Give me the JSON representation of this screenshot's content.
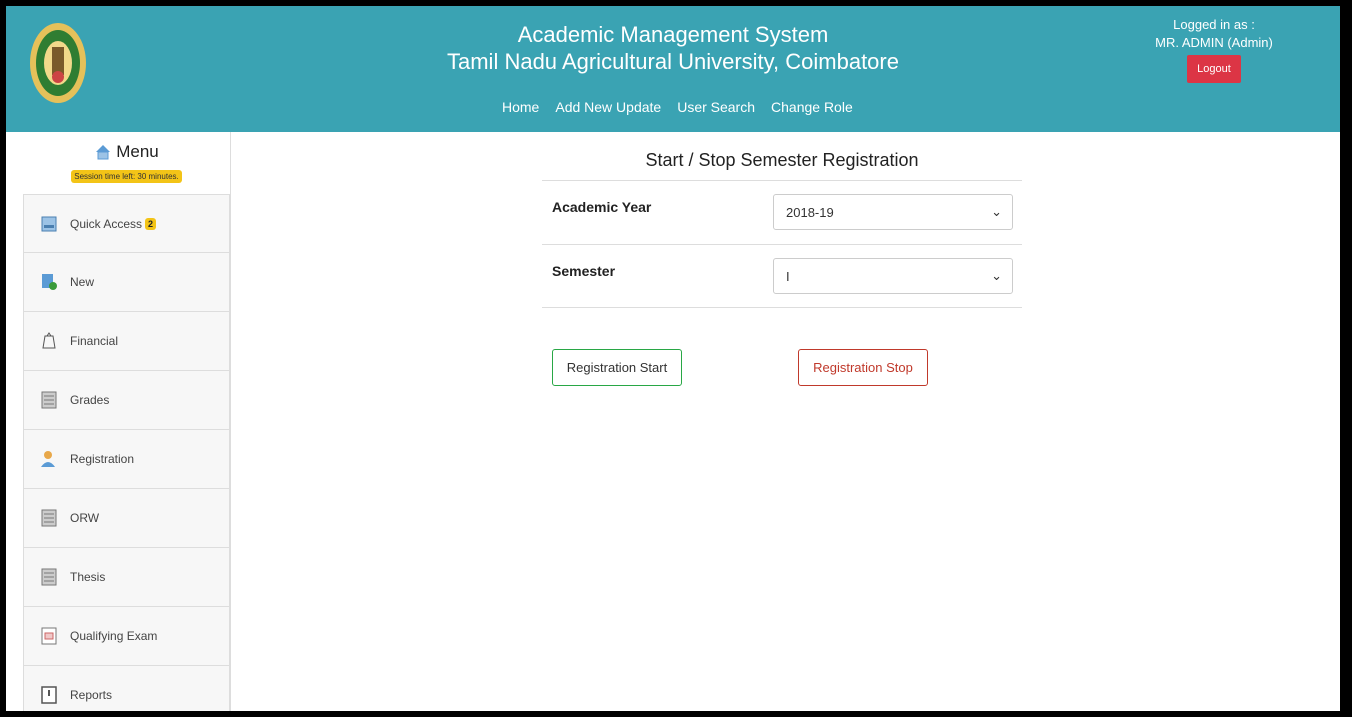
{
  "header": {
    "title_line1": "Academic Management System",
    "title_line2": "Tamil Nadu Agricultural University, Coimbatore",
    "nav": [
      "Home",
      "Add New Update",
      "User Search",
      "Change Role"
    ],
    "logged_in_label": "Logged in as :",
    "user": "MR. ADMIN (Admin)",
    "logout_label": "Logout",
    "color": "#3aa3b3"
  },
  "sidebar": {
    "menu_label": "Menu",
    "session_text": "Session time left: 30 minutes.",
    "items": [
      {
        "label": "Quick Access",
        "icon": "quick-access-icon",
        "badge": "2"
      },
      {
        "label": "New",
        "icon": "new-icon"
      },
      {
        "label": "Financial",
        "icon": "financial-icon"
      },
      {
        "label": "Grades",
        "icon": "grades-icon"
      },
      {
        "label": "Registration",
        "icon": "registration-icon"
      },
      {
        "label": "ORW",
        "icon": "orw-icon"
      },
      {
        "label": "Thesis",
        "icon": "thesis-icon"
      },
      {
        "label": "Qualifying Exam",
        "icon": "qualifying-exam-icon"
      },
      {
        "label": "Reports",
        "icon": "reports-icon"
      }
    ]
  },
  "main": {
    "title": "Start / Stop Semester Registration",
    "academic_year_label": "Academic Year",
    "academic_year_value": "2018-19",
    "semester_label": "Semester",
    "semester_value": "I",
    "start_button": "Registration Start",
    "stop_button": "Registration Stop"
  }
}
